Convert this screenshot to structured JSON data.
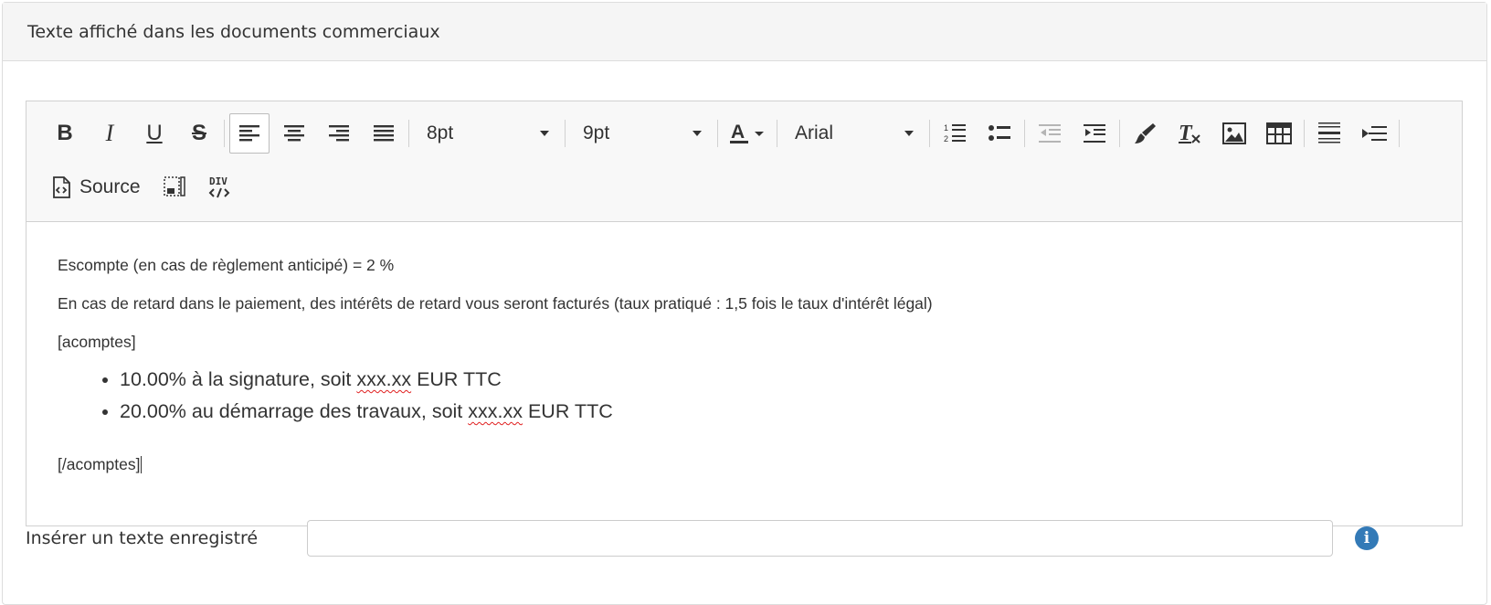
{
  "panel": {
    "title": "Texte affiché dans les documents commerciaux"
  },
  "toolbar": {
    "bold_label": "B",
    "italic_label": "I",
    "underline_label": "U",
    "strike_label": "S",
    "font_size_1": "8pt",
    "font_size_2": "9pt",
    "font_family": "Arial",
    "source_label": "Source",
    "icons": [
      "align-left-icon",
      "align-center-icon",
      "align-right-icon",
      "align-justify-icon",
      "text-color-icon",
      "numbered-list-icon",
      "bulleted-list-icon",
      "outdent-icon",
      "indent-icon",
      "paint-brush-icon",
      "remove-format-icon",
      "image-icon",
      "table-icon",
      "horizontal-rule-icon",
      "page-break-icon",
      "source-icon",
      "show-blocks-icon",
      "div-icon"
    ]
  },
  "content": {
    "line1": "Escompte (en cas de règlement anticipé) = 2 %",
    "line2": "En cas de retard dans le paiement, des intérêts de retard vous seront facturés (taux pratiqué : 1,5 fois le taux d'intérêt légal)",
    "acomptes_open": "[acomptes]",
    "bullets": [
      {
        "pre": "10.00% à la signature, soit ",
        "amount": "xxx.xx",
        "post": " EUR TTC"
      },
      {
        "pre": "20.00% au démarrage des travaux, soit ",
        "amount": "xxx.xx",
        "post": " EUR TTC"
      }
    ],
    "acomptes_close": "[/acomptes]"
  },
  "saved_text": {
    "label": "Insérer un texte enregistré",
    "value": "",
    "info_icon": "info-icon"
  },
  "colors": {
    "heading_bg": "#f5f5f5",
    "toolbar_bg": "#f8f8f8",
    "info_blue": "#337ab7"
  }
}
